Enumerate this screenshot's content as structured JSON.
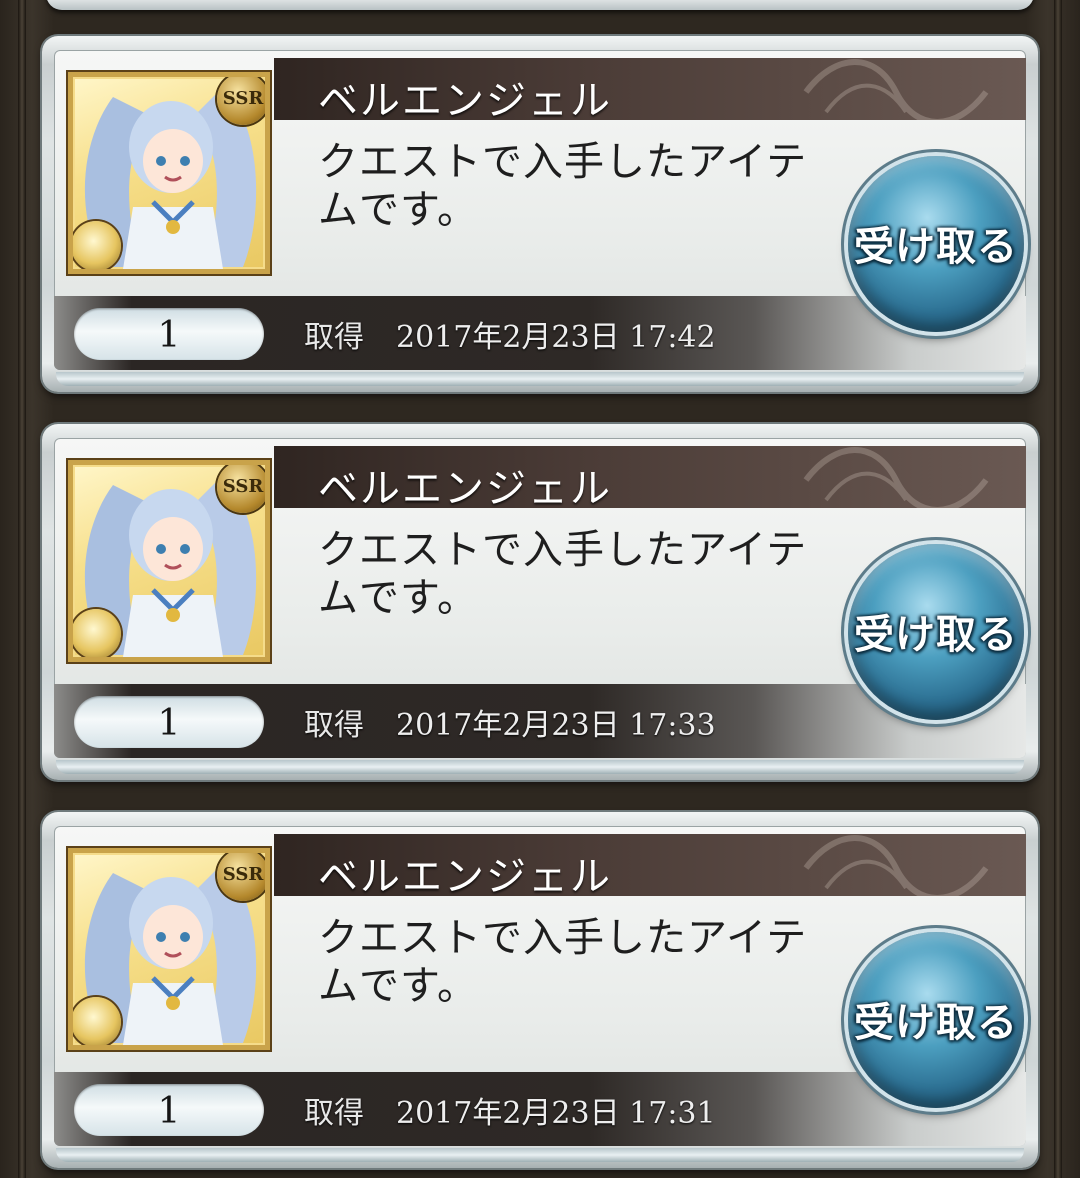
{
  "items": [
    {
      "name": "ベルエンジェル",
      "description": "クエストで入手したアイテムです。",
      "quantity": "1",
      "acquired_label": "取得",
      "acquired_at": "2017年2月23日 17:42",
      "rarity": "SSR",
      "receive_label": "受け取る"
    },
    {
      "name": "ベルエンジェル",
      "description": "クエストで入手したアイテムです。",
      "quantity": "1",
      "acquired_label": "取得",
      "acquired_at": "2017年2月23日 17:33",
      "rarity": "SSR",
      "receive_label": "受け取る"
    },
    {
      "name": "ベルエンジェル",
      "description": "クエストで入手したアイテムです。",
      "quantity": "1",
      "acquired_label": "取得",
      "acquired_at": "2017年2月23日 17:31",
      "rarity": "SSR",
      "receive_label": "受け取る"
    }
  ],
  "colors": {
    "title_bar": "#3a2e2a",
    "receive_button": "#3f8db0",
    "portrait_frame": "#c9a34a"
  },
  "icons": {
    "rarity_badge": "ssr-badge-icon",
    "element_badge": "light-element-icon",
    "portrait": "character-portrait-icon"
  }
}
